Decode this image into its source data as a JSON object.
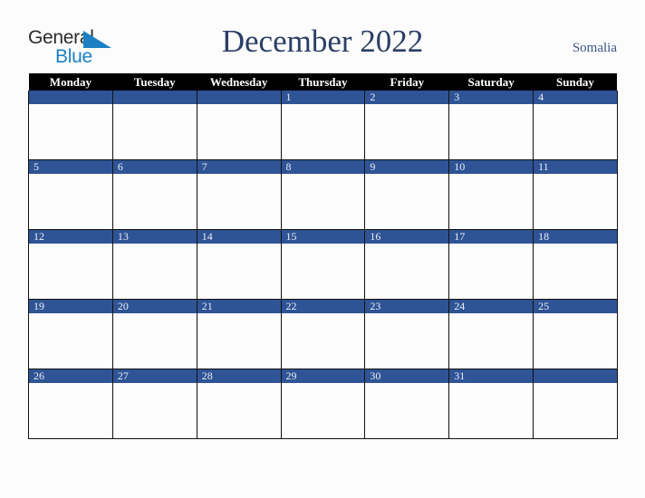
{
  "brand": {
    "name_part1": "General",
    "name_part2": "Blue",
    "triangle_icon": "blue-triangle-icon",
    "color_dark": "#2b2b2b",
    "color_blue": "#1c7fc4"
  },
  "header": {
    "title": "December 2022",
    "country": "Somalia",
    "title_color": "#2c3e66",
    "country_color": "#3c5488"
  },
  "calendar": {
    "accent_color": "#2f5496",
    "header_bg": "#000000",
    "header_text_color": "#ffffff",
    "weekdays": [
      "Monday",
      "Tuesday",
      "Wednesday",
      "Thursday",
      "Friday",
      "Saturday",
      "Sunday"
    ],
    "weeks": [
      [
        {
          "day": ""
        },
        {
          "day": ""
        },
        {
          "day": ""
        },
        {
          "day": "1"
        },
        {
          "day": "2"
        },
        {
          "day": "3"
        },
        {
          "day": "4"
        }
      ],
      [
        {
          "day": "5"
        },
        {
          "day": "6"
        },
        {
          "day": "7"
        },
        {
          "day": "8"
        },
        {
          "day": "9"
        },
        {
          "day": "10"
        },
        {
          "day": "11"
        }
      ],
      [
        {
          "day": "12"
        },
        {
          "day": "13"
        },
        {
          "day": "14"
        },
        {
          "day": "15"
        },
        {
          "day": "16"
        },
        {
          "day": "17"
        },
        {
          "day": "18"
        }
      ],
      [
        {
          "day": "19"
        },
        {
          "day": "20"
        },
        {
          "day": "21"
        },
        {
          "day": "22"
        },
        {
          "day": "23"
        },
        {
          "day": "24"
        },
        {
          "day": "25"
        }
      ],
      [
        {
          "day": "26"
        },
        {
          "day": "27"
        },
        {
          "day": "28"
        },
        {
          "day": "29"
        },
        {
          "day": "30"
        },
        {
          "day": "31"
        },
        {
          "day": ""
        }
      ]
    ]
  }
}
